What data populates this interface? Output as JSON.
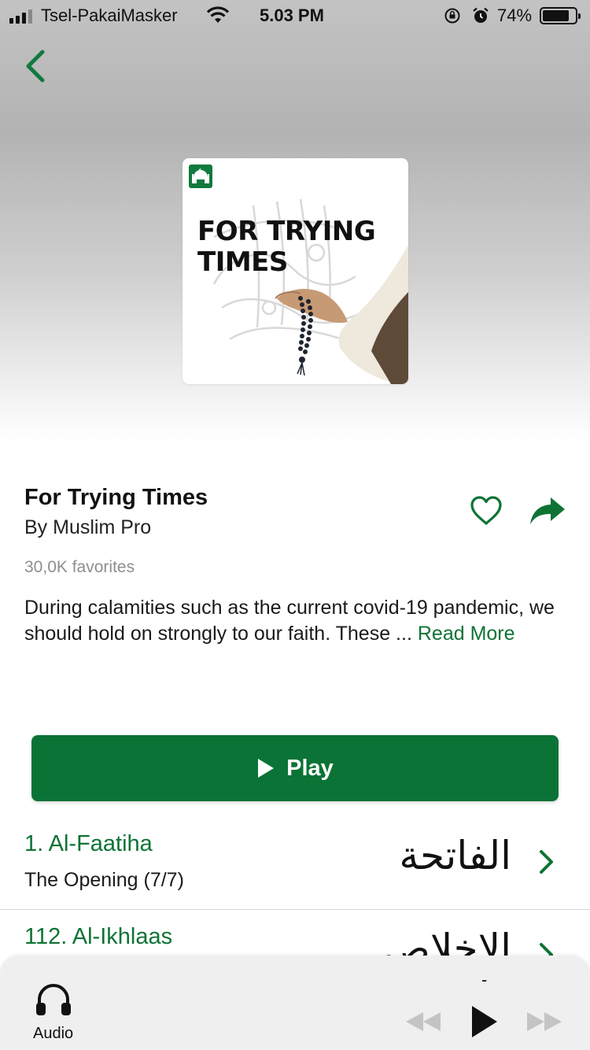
{
  "status_bar": {
    "carrier": "Tsel-PakaiMasker",
    "time": "5.03 PM",
    "battery": "74%",
    "battery_level": 0.74,
    "icons": [
      "signal-icon",
      "wifi-icon",
      "rotation-lock-icon",
      "alarm-icon",
      "battery-icon"
    ]
  },
  "nav": {
    "back_icon": "chevron-left-icon"
  },
  "cover": {
    "title": "FOR TRYING TIMES",
    "logo_icon": "mosque-icon"
  },
  "playlist": {
    "title": "For Trying Times",
    "author": "By Muslim Pro",
    "favorites": "30,0K favorites",
    "description": "During calamities such as the current covid-19 pandemic, we should hold on strongly to our faith. These ...",
    "read_more": "Read More",
    "heart_icon": "heart-outline-icon",
    "share_icon": "share-arrow-icon"
  },
  "play_button": {
    "label": "Play",
    "icon": "play-icon"
  },
  "items": [
    {
      "title": "1. Al-Faatiha",
      "subtitle": "The Opening (7/7)",
      "arabic": "الفاتحة"
    },
    {
      "title": "112. Al-Ikhlaas",
      "subtitle": "",
      "arabic": "الإخلاص"
    }
  ],
  "mini_player": {
    "tab_label": "Audio",
    "tab_icon": "headphones-icon",
    "now_playing": "-",
    "controls": [
      "rewind-icon",
      "play-icon",
      "fast-forward-icon"
    ]
  },
  "colors": {
    "accent": "#0b7335",
    "text": "#111111",
    "muted": "#8e8e8e",
    "player_bg": "#efefef"
  }
}
